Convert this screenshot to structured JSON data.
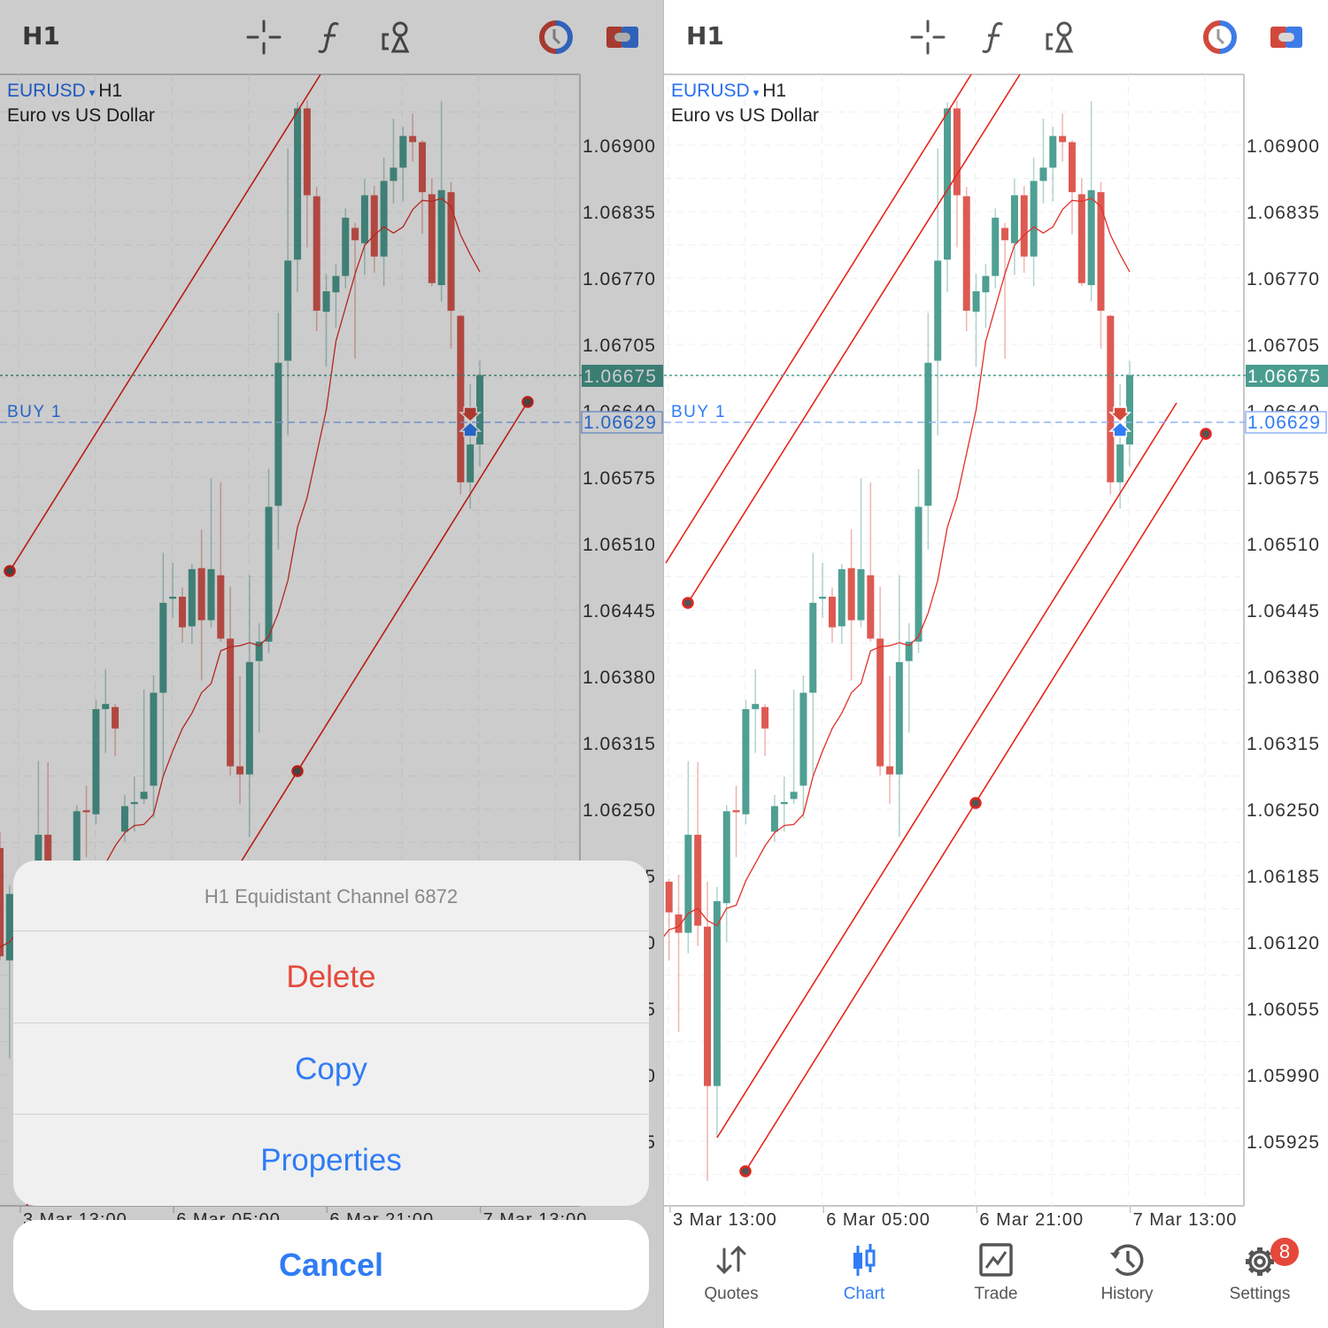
{
  "toolbar": {
    "timeframe": "H1",
    "icons": [
      "crosshair-icon",
      "indicator-f-icon",
      "objects-icon",
      "one-click-trading-icon",
      "trade-toggle-icon"
    ]
  },
  "symbol": {
    "name": "EURUSD",
    "dropdown_glyph": "▾",
    "timeframe": "H1",
    "description": "Euro vs US Dollar"
  },
  "colors": {
    "bull": "#4f9f93",
    "bear": "#dd5a52",
    "ma": "#e0302a",
    "channel": "#e8241c",
    "accent": "#2f7cf6",
    "current_price_bg": "#4a9d8f",
    "buy_line": "#8fb4f5"
  },
  "chart_data": {
    "type": "candlestick",
    "timeframe": "H1",
    "price_ticks": [
      "1.06900",
      "1.06835",
      "1.06770",
      "1.06705",
      "1.06640",
      "1.06575",
      "1.06510",
      "1.06445",
      "1.06380",
      "1.06315",
      "1.06250",
      "1.06185",
      "1.06120",
      "1.06055",
      "1.05990",
      "1.05925"
    ],
    "time_ticks": [
      "3 Mar 13:00",
      "6 Mar 05:00",
      "6 Mar 21:00",
      "7 Mar 13:00"
    ],
    "current_price": "1.06675",
    "order_line": {
      "label": "BUY 1",
      "price": "1.06629"
    },
    "candles_ohlc": [
      [
        1.06212,
        1.06228,
        1.06102,
        1.06106
      ],
      [
        1.06102,
        1.06175,
        1.06006,
        1.06167
      ],
      [
        1.06179,
        1.06182,
        1.06102,
        1.06149
      ],
      [
        1.06147,
        1.06186,
        1.06032,
        1.06129
      ],
      [
        1.06129,
        1.06297,
        1.06109,
        1.06225
      ],
      [
        1.06225,
        1.06296,
        1.06116,
        1.06136
      ],
      [
        1.06135,
        1.06179,
        1.05886,
        1.05979
      ],
      [
        1.05979,
        1.06174,
        1.05929,
        1.0616
      ],
      [
        1.06158,
        1.06254,
        1.0612,
        1.06248
      ],
      [
        1.06249,
        1.06273,
        1.06203,
        1.06247
      ],
      [
        1.06245,
        1.06357,
        1.06235,
        1.06348
      ],
      [
        1.06348,
        1.06387,
        1.06305,
        1.06353
      ],
      [
        1.0635,
        1.06353,
        1.06302,
        1.06329
      ],
      [
        1.06228,
        1.06264,
        1.06218,
        1.06253
      ],
      [
        1.06255,
        1.06282,
        1.06228,
        1.06257
      ],
      [
        1.0626,
        1.06367,
        1.06255,
        1.06267
      ],
      [
        1.06273,
        1.06381,
        1.06241,
        1.06364
      ],
      [
        1.06364,
        1.06501,
        1.06283,
        1.06452
      ],
      [
        1.06456,
        1.06491,
        1.06437,
        1.06458
      ],
      [
        1.06458,
        1.06467,
        1.06413,
        1.06428
      ],
      [
        1.06429,
        1.0649,
        1.06412,
        1.06485
      ],
      [
        1.06486,
        1.06524,
        1.06376,
        1.06435
      ],
      [
        1.06435,
        1.06574,
        1.06428,
        1.06485
      ],
      [
        1.06479,
        1.0657,
        1.06414,
        1.06417
      ],
      [
        1.06417,
        1.06468,
        1.06283,
        1.06292
      ],
      [
        1.06292,
        1.0638,
        1.06255,
        1.06284
      ],
      [
        1.06284,
        1.06479,
        1.06223,
        1.06394
      ],
      [
        1.06395,
        1.06432,
        1.06325,
        1.06414
      ],
      [
        1.06414,
        1.06583,
        1.06403,
        1.06546
      ],
      [
        1.06547,
        1.06736,
        1.06504,
        1.06687
      ],
      [
        1.06689,
        1.06897,
        1.06616,
        1.06787
      ],
      [
        1.06788,
        1.06942,
        1.06756,
        1.06936
      ],
      [
        1.06936,
        1.06944,
        1.068,
        1.06851
      ],
      [
        1.0685,
        1.06859,
        1.06718,
        1.06738
      ],
      [
        1.06737,
        1.06774,
        1.06683,
        1.06757
      ],
      [
        1.06756,
        1.06784,
        1.06721,
        1.06772
      ],
      [
        1.06772,
        1.06838,
        1.0676,
        1.06829
      ],
      [
        1.06819,
        1.06824,
        1.06691,
        1.06807
      ],
      [
        1.06804,
        1.06867,
        1.06773,
        1.06851
      ],
      [
        1.06851,
        1.0686,
        1.06775,
        1.06791
      ],
      [
        1.06791,
        1.06888,
        1.06762,
        1.06865
      ],
      [
        1.06865,
        1.06926,
        1.06843,
        1.06878
      ],
      [
        1.06878,
        1.06918,
        1.06845,
        1.06909
      ],
      [
        1.06909,
        1.06931,
        1.06884,
        1.06903
      ],
      [
        1.06903,
        1.06905,
        1.06813,
        1.06854
      ],
      [
        1.06852,
        1.06868,
        1.06762,
        1.06765
      ],
      [
        1.06763,
        1.06943,
        1.06747,
        1.06856
      ],
      [
        1.06854,
        1.06864,
        1.06701,
        1.06738
      ],
      [
        1.06733,
        1.06734,
        1.06558,
        1.0657
      ],
      [
        1.0657,
        1.06666,
        1.06544,
        1.06607
      ],
      [
        1.06607,
        1.06689,
        1.06585,
        1.06675
      ]
    ],
    "moving_average": [
      1.06115,
      1.0612,
      1.06132,
      1.06135,
      1.06148,
      1.06153,
      1.06141,
      1.06136,
      1.06153,
      1.06156,
      1.0618,
      1.06197,
      1.06214,
      1.06227,
      1.06234,
      1.06235,
      1.06245,
      1.06282,
      1.06307,
      1.06329,
      1.06344,
      1.06364,
      1.06373,
      1.06405,
      1.06409,
      1.0641,
      1.06413,
      1.0641,
      1.06419,
      1.06442,
      1.06474,
      1.06526,
      1.06555,
      1.06598,
      1.06641,
      1.06708,
      1.06741,
      1.06774,
      1.06802,
      1.06812,
      1.0682,
      1.06814,
      1.0682,
      1.06837,
      1.06846,
      1.06845,
      1.06848,
      1.0684,
      1.06812,
      1.06793,
      1.06776
    ]
  },
  "action_sheet": {
    "title": "H1 Equidistant Channel 6872",
    "delete": "Delete",
    "copy": "Copy",
    "properties": "Properties",
    "cancel": "Cancel"
  },
  "tabbar": {
    "items": [
      {
        "label": "Quotes",
        "icon": "quotes-arrows-icon"
      },
      {
        "label": "Chart",
        "icon": "chart-candles-icon",
        "active": true
      },
      {
        "label": "Trade",
        "icon": "trade-chart-icon"
      },
      {
        "label": "History",
        "icon": "history-clock-icon"
      },
      {
        "label": "Settings",
        "icon": "settings-gear-icon",
        "badge": "8"
      }
    ]
  }
}
